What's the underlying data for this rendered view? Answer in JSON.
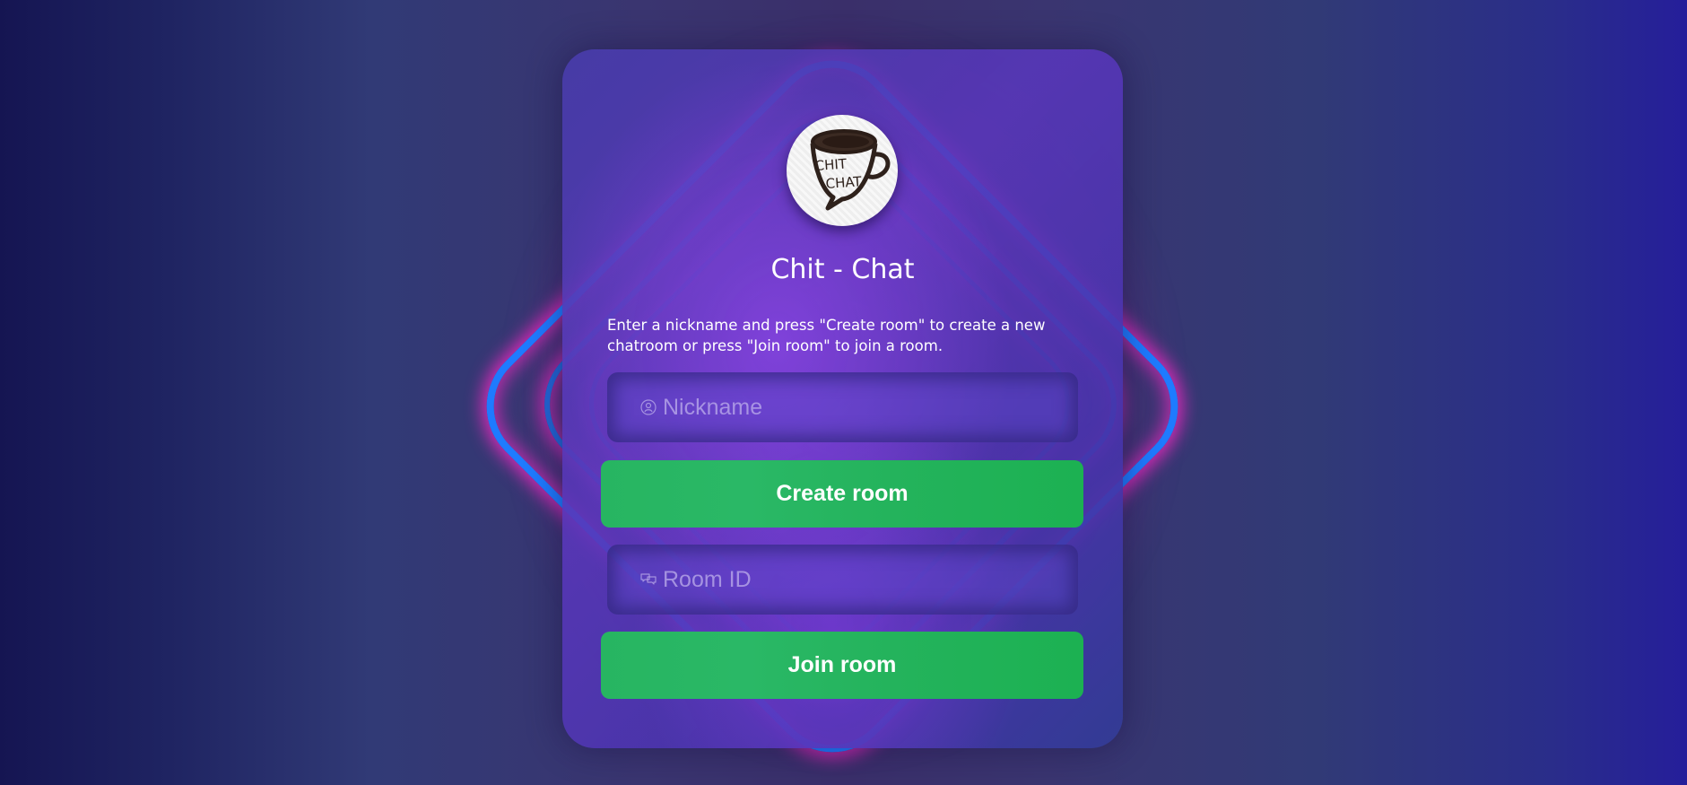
{
  "app": {
    "title": "Chit - Chat",
    "logo_text": "CHIT CHAT.",
    "description": "Enter a nickname and press \"Create room\" to create a new chatroom or press \"Join room\" to join a room."
  },
  "nickname": {
    "placeholder": "Nickname",
    "value": "",
    "icon": "user-icon"
  },
  "create_button": {
    "label": "Create room"
  },
  "room_id": {
    "placeholder": "Room ID",
    "value": "",
    "icon": "chat-bubbles-icon"
  },
  "join_button": {
    "label": "Join room"
  },
  "colors": {
    "button_green": "#22b45c",
    "neon_blue": "#1e7bff",
    "neon_pink": "#ff28c8",
    "card_purple": "#5a3cb9"
  }
}
